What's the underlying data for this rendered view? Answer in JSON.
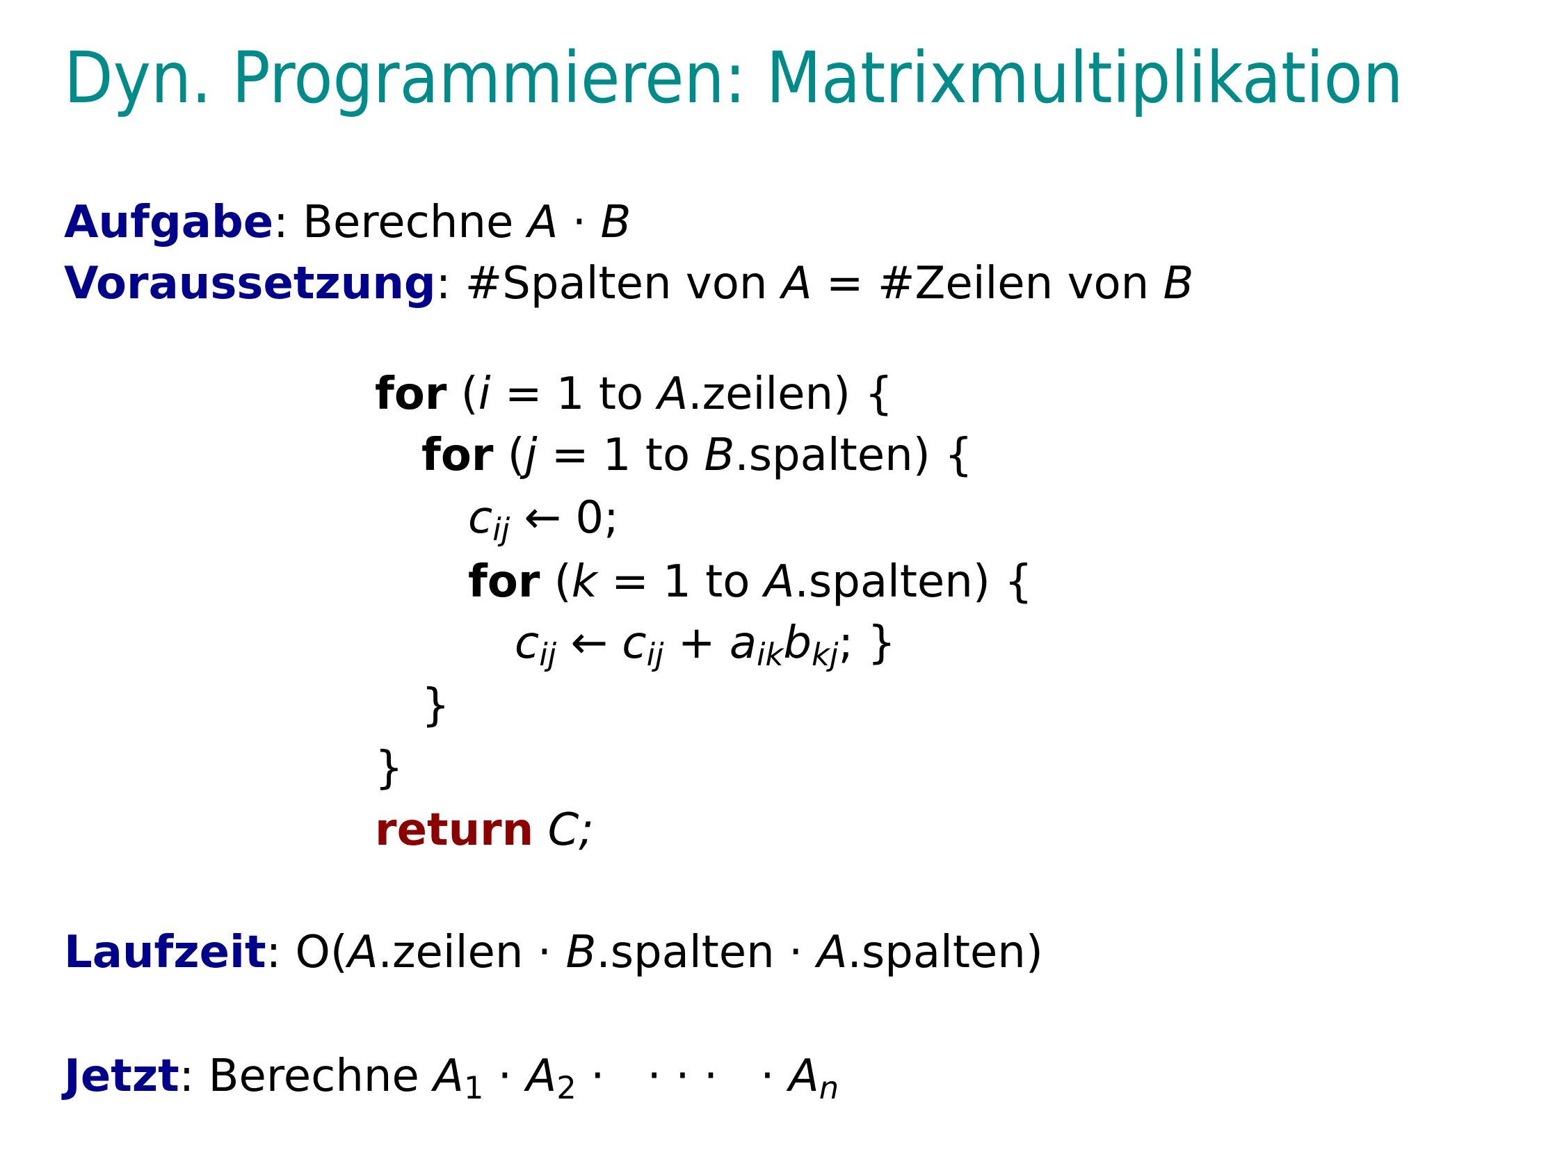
{
  "title": "Dyn. Programmieren: Matrixmultiplikation",
  "colors": {
    "title": "#008b8b",
    "keyword": "#00008b",
    "return": "#8b0000"
  },
  "aufgabe": {
    "label": "Aufgabe",
    "text": ": Berechne ",
    "a": "A",
    "dot": " · ",
    "b": "B"
  },
  "voraussetzung": {
    "label": "Voraussetzung",
    "text1": ": #Spalten von ",
    "a": "A",
    "text2": " = #Zeilen von ",
    "b": "B"
  },
  "code": {
    "for": "for",
    "line1": {
      "open": " (",
      "var": "i",
      "mid": " = 1 to ",
      "obj": "A",
      "rest": ".zeilen) {"
    },
    "line2": {
      "open": " (",
      "var": "j",
      "mid": " = 1 to ",
      "obj": "B",
      "rest": ".spalten) {"
    },
    "line3": {
      "c": "c",
      "ij": "ij",
      "rest": " ← 0;"
    },
    "line4": {
      "open": " (",
      "var": "k",
      "mid": " = 1 to ",
      "obj": "A",
      "rest": ".spalten) {"
    },
    "line5": {
      "c": "c",
      "ij": "ij",
      "arrow": " ← ",
      "c2": "c",
      "ij2": "ij",
      "plus": " + ",
      "a": "a",
      "ik": "ik",
      "b": "b",
      "kj": "kj",
      "end": "; }"
    },
    "close_inner": "}",
    "close_outer": "}",
    "return": "return",
    "return_value": " C;"
  },
  "laufzeit": {
    "label": "Laufzeit",
    "text": ": O(",
    "a1": "A",
    "t1": ".zeilen · ",
    "b": "B",
    "t2": ".spalten · ",
    "a2": "A",
    "t3": ".spalten)"
  },
  "jetzt": {
    "label": "Jetzt",
    "text": ": Berechne ",
    "a": "A",
    "s1": "1",
    "dot1": " · ",
    "a2": "A",
    "s2": "2",
    "dots": " ·   · · ·   · ",
    "an": "A",
    "sn": "n"
  }
}
